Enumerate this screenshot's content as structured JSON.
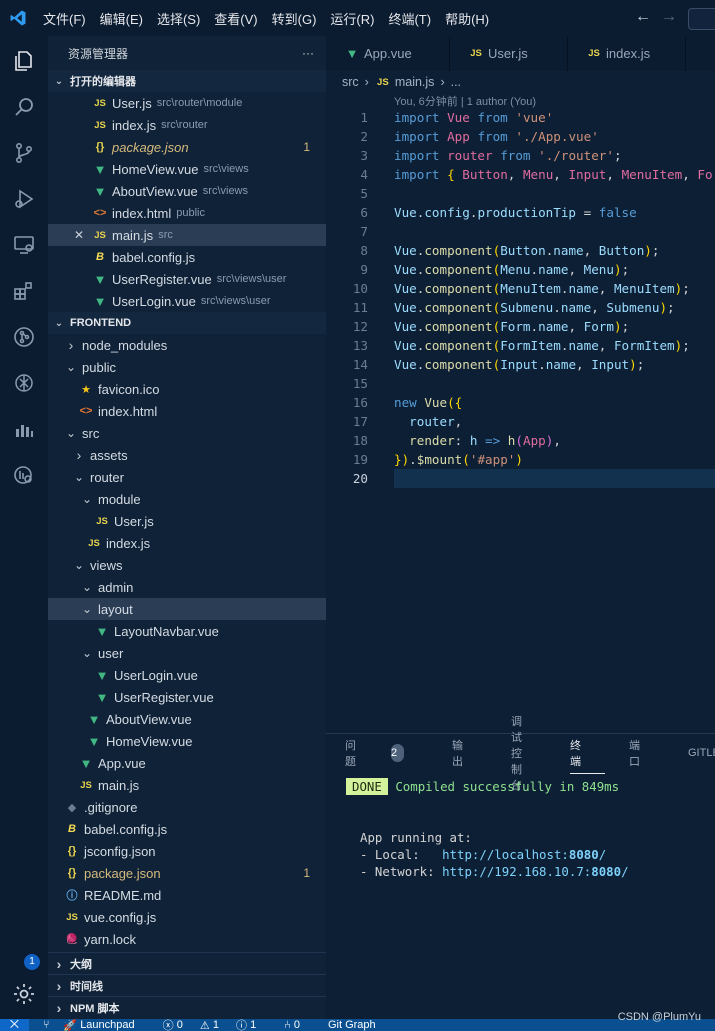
{
  "menu": [
    "文件(F)",
    "编辑(E)",
    "选择(S)",
    "查看(V)",
    "转到(G)",
    "运行(R)",
    "终端(T)",
    "帮助(H)"
  ],
  "sidebar": {
    "title": "资源管理器",
    "more": "···",
    "open_editors_header": "打开的编辑器",
    "open_editors": [
      {
        "name": "User.js",
        "desc": "src\\router\\module",
        "type": "js"
      },
      {
        "name": "index.js",
        "desc": "src\\router",
        "type": "js"
      },
      {
        "name": "package.json",
        "desc": "",
        "type": "json",
        "badge": "1"
      },
      {
        "name": "HomeView.vue",
        "desc": "src\\views",
        "type": "vue"
      },
      {
        "name": "AboutView.vue",
        "desc": "src\\views",
        "type": "vue"
      },
      {
        "name": "index.html",
        "desc": "public",
        "type": "html"
      },
      {
        "name": "main.js",
        "desc": "src",
        "type": "js"
      },
      {
        "name": "babel.config.js",
        "desc": "",
        "type": "babel"
      },
      {
        "name": "UserRegister.vue",
        "desc": "src\\views\\user",
        "type": "vue"
      },
      {
        "name": "UserLogin.vue",
        "desc": "src\\views\\user",
        "type": "vue"
      }
    ],
    "project_header": "FRONTEND",
    "tree": [
      {
        "name": "node_modules",
        "depth": 0,
        "kind": "folder",
        "open": false
      },
      {
        "name": "public",
        "depth": 0,
        "kind": "folder",
        "open": true
      },
      {
        "name": "favicon.ico",
        "depth": 1,
        "kind": "star"
      },
      {
        "name": "index.html",
        "depth": 1,
        "kind": "html"
      },
      {
        "name": "src",
        "depth": 0,
        "kind": "folder",
        "open": true
      },
      {
        "name": "assets",
        "depth": 1,
        "kind": "folder",
        "open": false
      },
      {
        "name": "router",
        "depth": 1,
        "kind": "folder",
        "open": true
      },
      {
        "name": "module",
        "depth": 2,
        "kind": "folder",
        "open": true
      },
      {
        "name": "User.js",
        "depth": 3,
        "kind": "js"
      },
      {
        "name": "index.js",
        "depth": 2,
        "kind": "js"
      },
      {
        "name": "views",
        "depth": 1,
        "kind": "folder",
        "open": true
      },
      {
        "name": "admin",
        "depth": 2,
        "kind": "folder",
        "open": true
      },
      {
        "name": "layout",
        "depth": 2,
        "kind": "folder",
        "open": true
      },
      {
        "name": "LayoutNavbar.vue",
        "depth": 3,
        "kind": "vue"
      },
      {
        "name": "user",
        "depth": 2,
        "kind": "folder",
        "open": true
      },
      {
        "name": "UserLogin.vue",
        "depth": 3,
        "kind": "vue"
      },
      {
        "name": "UserRegister.vue",
        "depth": 3,
        "kind": "vue"
      },
      {
        "name": "AboutView.vue",
        "depth": 2,
        "kind": "vue"
      },
      {
        "name": "HomeView.vue",
        "depth": 2,
        "kind": "vue"
      },
      {
        "name": "App.vue",
        "depth": 1,
        "kind": "vue"
      },
      {
        "name": "main.js",
        "depth": 1,
        "kind": "js"
      },
      {
        "name": ".gitignore",
        "depth": 0,
        "kind": "git"
      },
      {
        "name": "babel.config.js",
        "depth": 0,
        "kind": "babel"
      },
      {
        "name": "jsconfig.json",
        "depth": 0,
        "kind": "jsonb"
      },
      {
        "name": "package.json",
        "depth": 0,
        "kind": "json",
        "badge": "1"
      },
      {
        "name": "README.md",
        "depth": 0,
        "kind": "info"
      },
      {
        "name": "vue.config.js",
        "depth": 0,
        "kind": "js"
      },
      {
        "name": "yarn.lock",
        "depth": 0,
        "kind": "yarn"
      }
    ],
    "bottom_sections": [
      "大纲",
      "时间线",
      "NPM 脚本"
    ]
  },
  "tabs": [
    {
      "label": "App.vue",
      "type": "vue"
    },
    {
      "label": "User.js",
      "type": "js"
    },
    {
      "label": "index.js",
      "type": "js"
    }
  ],
  "breadcrumb": {
    "folder": "src",
    "file": "main.js",
    "rest": "..."
  },
  "editor": {
    "blame": "You, 6分钟前 | 1 author (You)",
    "line_numbers": [
      "1",
      "2",
      "3",
      "4",
      "5",
      "6",
      "7",
      "8",
      "9",
      "10",
      "11",
      "12",
      "13",
      "14",
      "15",
      "16",
      "17",
      "18",
      "19",
      "20"
    ]
  },
  "panel": {
    "tabs": [
      "问题",
      "输出",
      "调试控制台",
      "终端",
      "端口",
      "GITLENS"
    ],
    "problems_count": "2",
    "active_tab": "终端",
    "done": "DONE",
    "compiled": "Compiled successfully in 849ms",
    "running": "App running at:",
    "local_label": "- Local:   ",
    "local_url": "http://localhost:",
    "local_port": "8080",
    "network_label": "- Network: ",
    "network_url": "http://192.168.10.7:",
    "network_port": "8080"
  },
  "status": {
    "launchpad": "Launchpad",
    "errors": "0",
    "warnings": "1",
    "info": "1",
    "ports": "0",
    "git_graph": "Git Graph"
  },
  "gear_badge": "1",
  "watermark": "CSDN @PlumYu"
}
